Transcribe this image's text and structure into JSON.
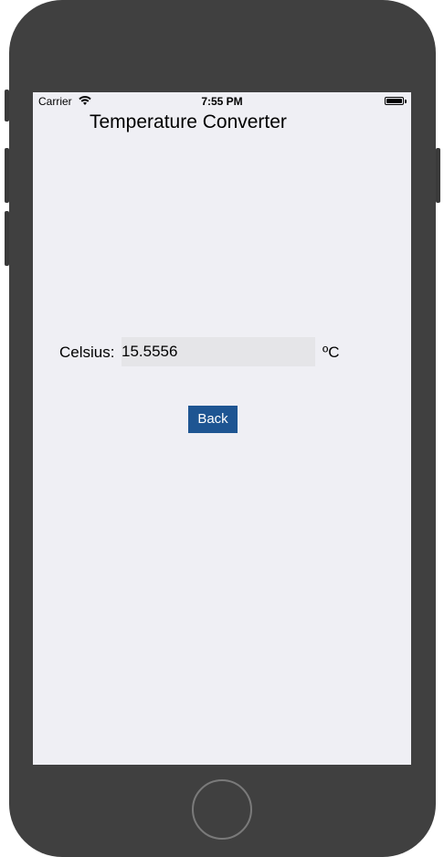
{
  "status_bar": {
    "carrier": "Carrier",
    "time": "7:55 PM",
    "wifi_icon": "wifi-icon",
    "battery_icon": "battery-icon"
  },
  "app": {
    "title": "Temperature Converter"
  },
  "form": {
    "celsius_label": "Celsius:",
    "celsius_value": "15.5556",
    "unit": "ºC",
    "back_label": "Back"
  },
  "colors": {
    "screen_bg": "#efeff4",
    "input_bg": "#e5e5e8",
    "button_bg": "#1e5592",
    "device_body": "#404040"
  }
}
